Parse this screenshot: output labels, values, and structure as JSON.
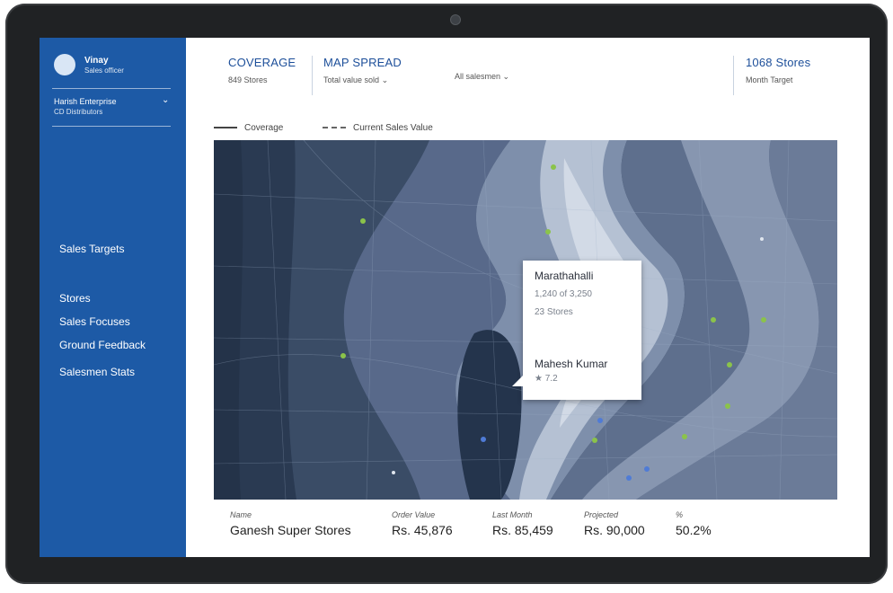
{
  "sidebar": {
    "user_name": "Vinay",
    "user_role": "Sales officer",
    "enterprise": "Harish Enterprise",
    "enterprise_sub": "CD Distributors",
    "nav": [
      "Sales Targets",
      "Stores",
      "Sales Focuses",
      "Ground Feedback",
      "Salesmen Stats"
    ]
  },
  "topbar": {
    "coverage_title": "COVERAGE",
    "coverage_sub": "849 Stores",
    "map_spread_title": "MAP SPREAD",
    "map_spread_select": "Total value sold",
    "salesmen_select": "All salesmen",
    "target_title": "1068 Stores",
    "target_sub": "Month Target"
  },
  "legend": {
    "coverage": "Coverage",
    "current_sales": "Current Sales Value"
  },
  "tooltip": {
    "area": "Marathahalli",
    "progress": "1,240 of 3,250",
    "stores": "23 Stores",
    "salesman": "Mahesh Kumar",
    "rating": "★ 7.2"
  },
  "stats": [
    {
      "label": "Name",
      "value": "Ganesh Super Stores"
    },
    {
      "label": "Order Value",
      "value": "Rs. 45,876"
    },
    {
      "label": "Last Month",
      "value": "Rs. 85,459"
    },
    {
      "label": "Projected",
      "value": "Rs. 90,000"
    },
    {
      "label": "%",
      "value": "50.2%"
    }
  ],
  "colors": {
    "sidebar": "#1d5aa6",
    "accent": "#1d4f9a",
    "map_dark": "#2f3f57"
  }
}
